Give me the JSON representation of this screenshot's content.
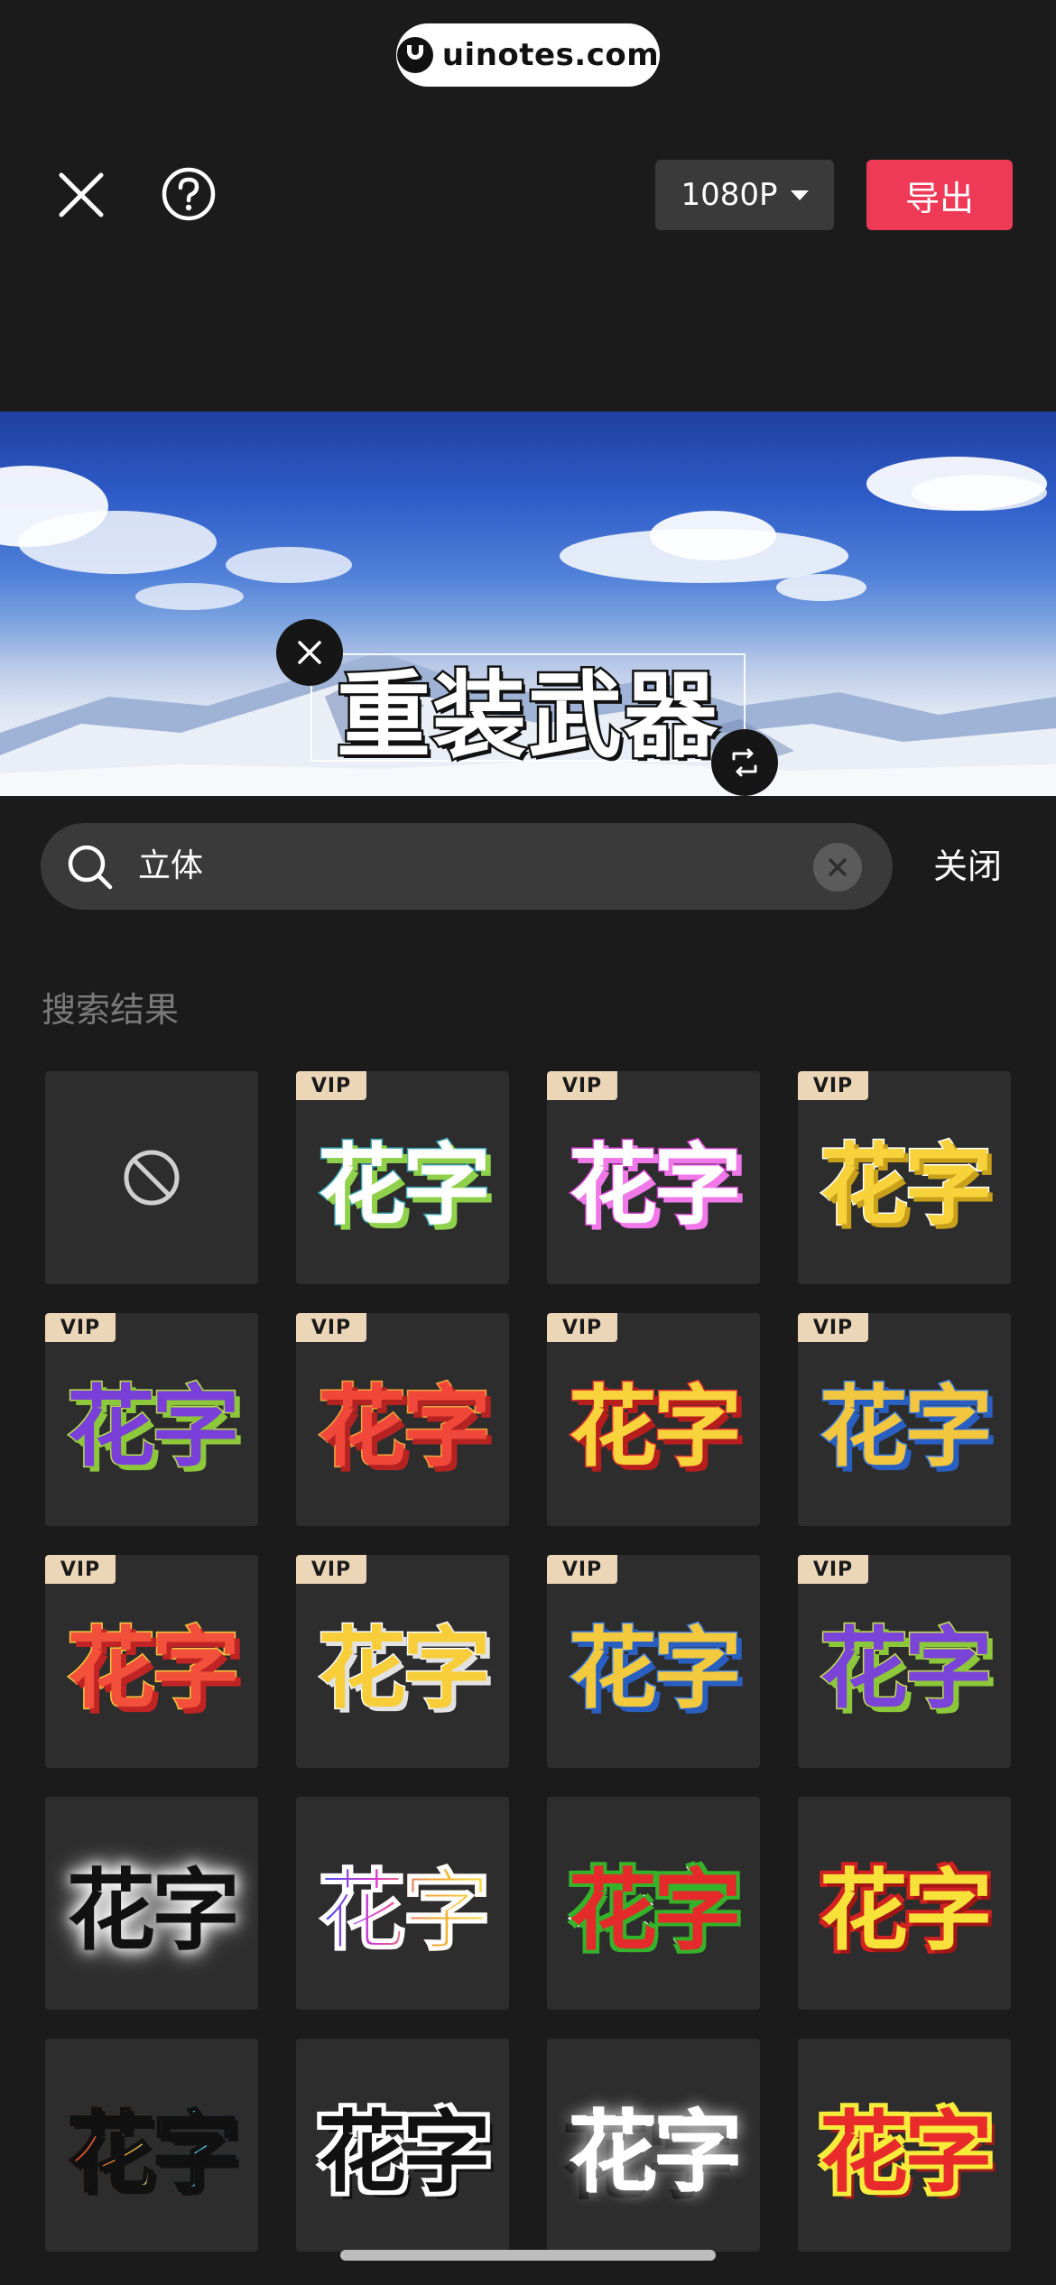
{
  "watermark": {
    "text": "uinotes.com"
  },
  "toolbar": {
    "resolution_label": "1080P",
    "export_label": "导出",
    "close_icon": "close-icon",
    "help_icon": "help-circle-icon"
  },
  "preview": {
    "text_content": "重装武器",
    "delete_icon": "close-icon",
    "rotate_icon": "rotate-scale-icon"
  },
  "search": {
    "value": "立体",
    "clear_icon": "clear-circle-icon",
    "close_label": "关闭"
  },
  "results": {
    "title": "搜索结果",
    "vip_label": "VIP",
    "sample_text": "花字",
    "items": [
      {
        "style": "none",
        "vip": false
      },
      {
        "style": "white-3d-green",
        "vip": true
      },
      {
        "style": "white-3d-pink",
        "vip": true
      },
      {
        "style": "yellow-3d",
        "vip": true
      },
      {
        "style": "purple-green",
        "vip": true
      },
      {
        "style": "red-orange",
        "vip": true
      },
      {
        "style": "yellow-red",
        "vip": true
      },
      {
        "style": "blue-yellow",
        "vip": true
      },
      {
        "style": "red-yellow",
        "vip": true
      },
      {
        "style": "yellow-white",
        "vip": true
      },
      {
        "style": "yellow-blue",
        "vip": true
      },
      {
        "style": "purple-yellow",
        "vip": true
      },
      {
        "style": "black-glow",
        "vip": false
      },
      {
        "style": "rainbow",
        "vip": false
      },
      {
        "style": "red-green-outline",
        "vip": false
      },
      {
        "style": "yellow-red-outline",
        "vip": false
      },
      {
        "style": "rainbow-black",
        "vip": false
      },
      {
        "style": "black-bubble",
        "vip": false
      },
      {
        "style": "white-glow-dark",
        "vip": false
      },
      {
        "style": "red-yellow-bubble",
        "vip": false
      }
    ]
  },
  "colors": {
    "accent": "#ef3a57",
    "vip_badge": "#ecd6b8",
    "tile_bg": "#2d2d2d"
  }
}
